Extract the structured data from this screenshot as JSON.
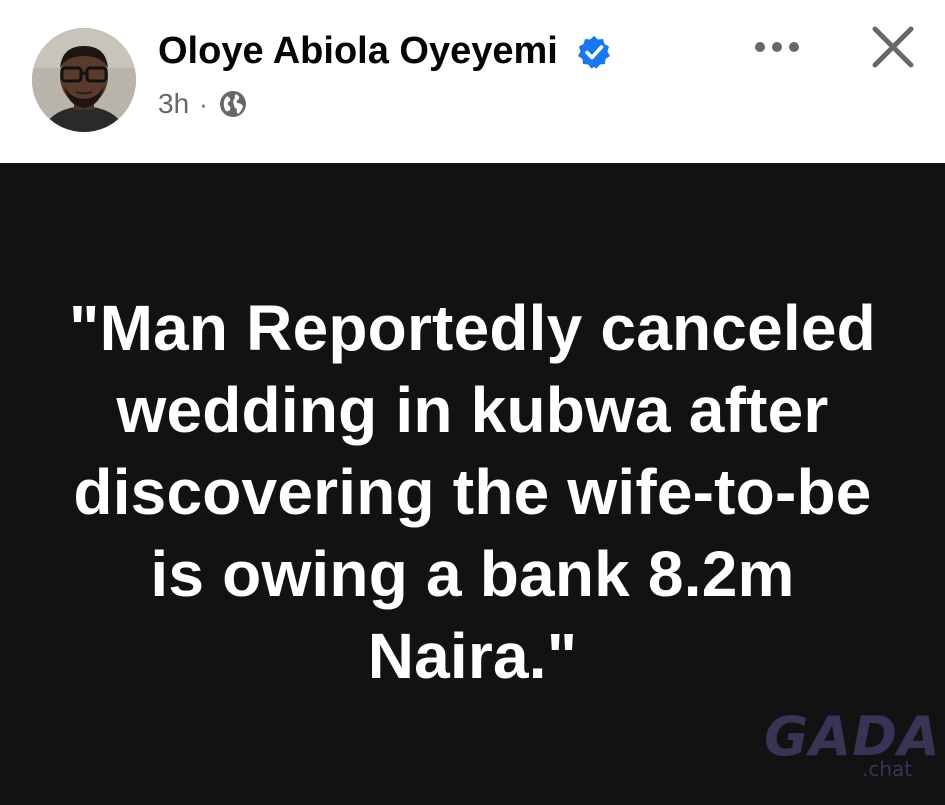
{
  "post": {
    "author": {
      "name": "Oloye Abiola Oyeyemi",
      "verified": true,
      "avatar_icon": "profile-photo"
    },
    "meta": {
      "time": "3h",
      "separator": "·",
      "audience_icon": "globe-icon"
    },
    "actions": {
      "more_icon": "more-options-icon",
      "close_icon": "close-icon"
    },
    "content": {
      "background_color": "#121212",
      "text_color": "#ffffff",
      "text": "\"Man Reportedly canceled wedding in kubwa after discovering the wife-to-be is owing a bank 8.2m Naira.\""
    },
    "watermark": {
      "logo": "GADA",
      "sub": ".chat"
    }
  },
  "colors": {
    "verified_badge": "#1877f2",
    "secondary_text": "#65676b",
    "watermark": "#3a3356"
  }
}
